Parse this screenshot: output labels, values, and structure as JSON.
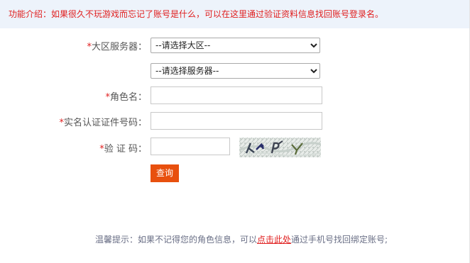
{
  "intro": {
    "text": "功能介绍：如果很久不玩游戏而忘记了账号是什么，可以在这里通过验证资料信息找回账号登录名。"
  },
  "colors": {
    "required_marker": "#e02020",
    "intro_background": "#edf3fb",
    "button_background": "#e8500e",
    "tip_text": "#6a6f86"
  },
  "form": {
    "required_mark": "*",
    "region": {
      "label": "大区服务器：",
      "selected": "--请选择大区--"
    },
    "server": {
      "selected": "--请选择服务器--"
    },
    "role_name": {
      "label": "角色名：",
      "value": ""
    },
    "id_number": {
      "label": "实名认证证件号码：",
      "value": ""
    },
    "captcha": {
      "label": "验 证 码：",
      "value": ""
    },
    "submit_label": "查询"
  },
  "tip": {
    "prefix": "温馨提示：如果不记得您的角色信息，可以",
    "link_text": "点击此处",
    "suffix": "通过手机号找回绑定账号;"
  }
}
